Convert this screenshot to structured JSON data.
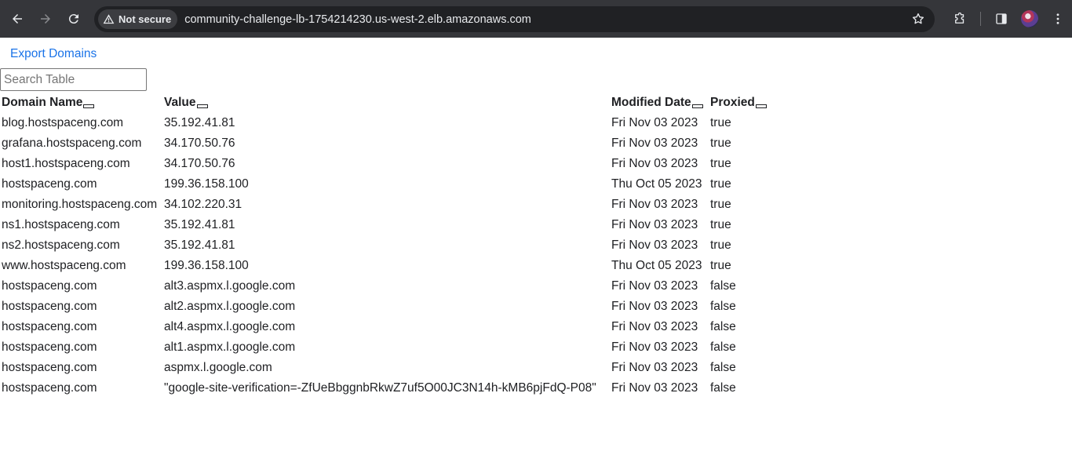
{
  "browser": {
    "security_label": "Not secure",
    "url": "community-challenge-lb-1754214230.us-west-2.elb.amazonaws.com",
    "icons": [
      "back-arrow-icon",
      "forward-arrow-icon",
      "reload-icon",
      "warning-icon",
      "star-icon",
      "extensions-icon",
      "side-panel-icon",
      "profile-avatar",
      "more-vert-icon"
    ]
  },
  "page": {
    "export_label": "Export Domains",
    "search_placeholder": "Search Table"
  },
  "table": {
    "headers": [
      "Domain Name",
      "Value",
      "Modified Date",
      "Proxied"
    ],
    "rows": [
      [
        "blog.hostspaceng.com",
        "35.192.41.81",
        "Fri Nov 03 2023",
        "true"
      ],
      [
        "grafana.hostspaceng.com",
        "34.170.50.76",
        "Fri Nov 03 2023",
        "true"
      ],
      [
        "host1.hostspaceng.com",
        "34.170.50.76",
        "Fri Nov 03 2023",
        "true"
      ],
      [
        "hostspaceng.com",
        "199.36.158.100",
        "Thu Oct 05 2023",
        "true"
      ],
      [
        "monitoring.hostspaceng.com",
        "34.102.220.31",
        "Fri Nov 03 2023",
        "true"
      ],
      [
        "ns1.hostspaceng.com",
        "35.192.41.81",
        "Fri Nov 03 2023",
        "true"
      ],
      [
        "ns2.hostspaceng.com",
        "35.192.41.81",
        "Fri Nov 03 2023",
        "true"
      ],
      [
        "www.hostspaceng.com",
        "199.36.158.100",
        "Thu Oct 05 2023",
        "true"
      ],
      [
        "hostspaceng.com",
        "alt3.aspmx.l.google.com",
        "Fri Nov 03 2023",
        "false"
      ],
      [
        "hostspaceng.com",
        "alt2.aspmx.l.google.com",
        "Fri Nov 03 2023",
        "false"
      ],
      [
        "hostspaceng.com",
        "alt4.aspmx.l.google.com",
        "Fri Nov 03 2023",
        "false"
      ],
      [
        "hostspaceng.com",
        "alt1.aspmx.l.google.com",
        "Fri Nov 03 2023",
        "false"
      ],
      [
        "hostspaceng.com",
        "aspmx.l.google.com",
        "Fri Nov 03 2023",
        "false"
      ],
      [
        "hostspaceng.com",
        "\"google-site-verification=-ZfUeBbggnbRkwZ7uf5O00JC3N14h-kMB6pjFdQ-P08\"",
        "Fri Nov 03 2023",
        "false"
      ]
    ]
  },
  "colors": {
    "toolbar_bg": "#35363a",
    "omnibox_bg": "#202124",
    "link": "#1a73e8"
  }
}
